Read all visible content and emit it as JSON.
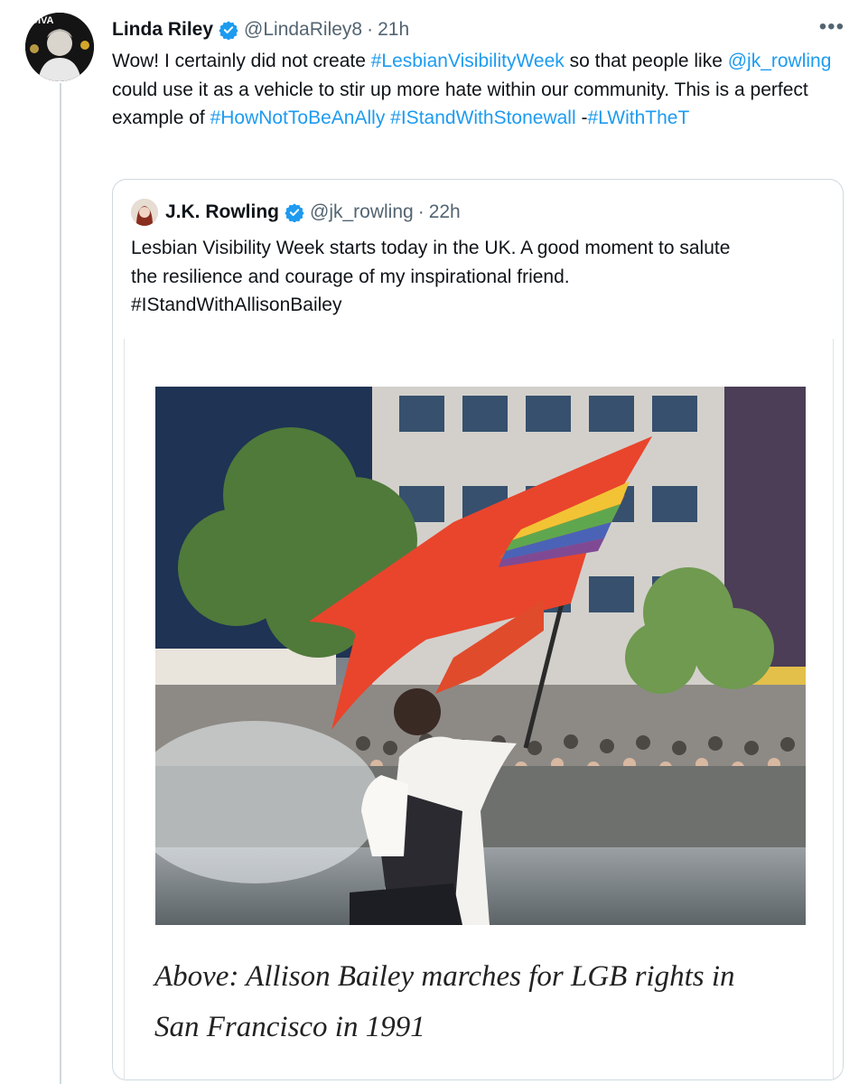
{
  "tweet": {
    "author_name": "Linda Riley",
    "handle": "@LindaRiley8",
    "separator": "·",
    "time": "21h",
    "more_label": "•••",
    "avatar_badge": "DIVA",
    "text_parts": [
      {
        "t": "Wow! I certainly did not create ",
        "link": false
      },
      {
        "t": "#LesbianVisibilityWeek",
        "link": true
      },
      {
        "t": " so that people like ",
        "link": false
      },
      {
        "t": "@jk_rowling",
        "link": true
      },
      {
        "t": " could use it as a vehicle to stir up more hate within our community.  This is a perfect example of ",
        "link": false
      },
      {
        "t": "#HowNotToBeAnAlly",
        "link": true
      },
      {
        "t": " ",
        "link": false
      },
      {
        "t": "#IStandWithStonewall",
        "link": true
      },
      {
        "t": " -",
        "link": false
      },
      {
        "t": "#LWithTheT",
        "link": true
      }
    ]
  },
  "quote": {
    "author_name": "J.K. Rowling",
    "handle": "@jk_rowling",
    "separator": "·",
    "time": "22h",
    "text_line1": "Lesbian Visibility Week starts today in the UK. A good moment to salute",
    "text_line2": "the resilience and courage of my inspirational friend.",
    "text_line3": "#IStandWithAllisonBailey",
    "caption_line1": "Above: Allison Bailey marches for LGB rights in",
    "caption_line2": "San Francisco in 1991"
  },
  "colors": {
    "link": "#1d9bf0",
    "verified": "#1d9bf0",
    "muted": "#536471",
    "flag_red": "#e8452c"
  },
  "icons": {
    "verified": "verified-badge-icon",
    "more": "more-options-icon"
  }
}
